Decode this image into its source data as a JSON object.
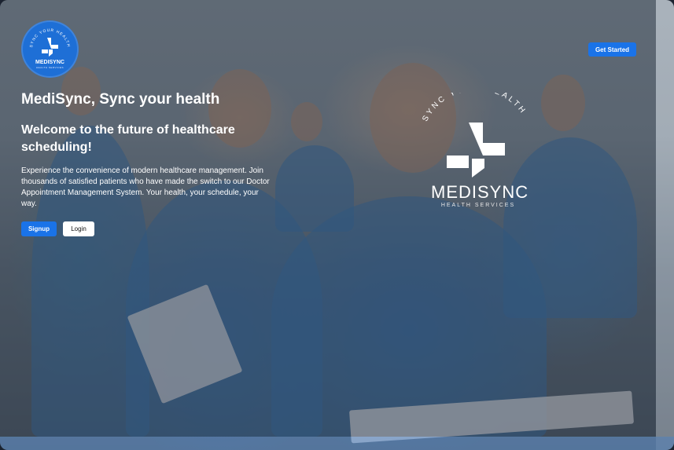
{
  "brand": {
    "badge_ring_text": "SYNC YOUR HEALTH",
    "badge_name": "MEDISYNC",
    "badge_tagline": "HEALTH SERVICES",
    "accent_color": "#1a73e8"
  },
  "header": {
    "cta_label": "Get Started"
  },
  "hero": {
    "title": "MediSync, Sync your health",
    "subtitle": "Welcome to the future of healthcare scheduling!",
    "description": "Experience the convenience of modern healthcare management. Join thousands of satisfied patients who have made the switch to our Doctor Appointment Management System. Your health, your schedule, your way.",
    "signup_label": "Signup",
    "login_label": "Login"
  },
  "watermark_logo": {
    "ring_text": "SYNC YOUR HEALTH",
    "name": "MEDISYNC",
    "tagline": "HEALTH SERVICES"
  }
}
